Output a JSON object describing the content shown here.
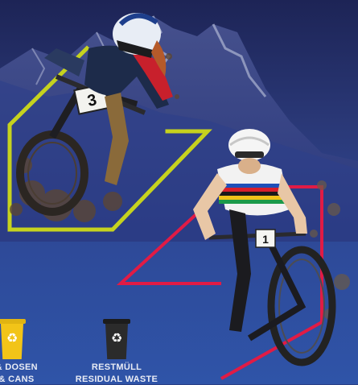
{
  "bins": [
    {
      "label_de": "K & DOSEN",
      "label_en": "S & CANS",
      "bin_color": "#f2c418",
      "lid_color": "#e0b412",
      "icon": "recycle-icon"
    },
    {
      "label_de": "RESTMÜLL",
      "label_en": "RESIDUAL WASTE",
      "bin_color": "#2b2b2b",
      "lid_color": "#1c1c1c",
      "icon": "recycle-icon"
    }
  ],
  "rider_left": {
    "plate_number": "3"
  },
  "rider_right": {
    "plate_number": "1"
  },
  "colors": {
    "frame_left": "#c6d21e",
    "frame_right": "#e11b45",
    "background": "#2a3f86"
  }
}
